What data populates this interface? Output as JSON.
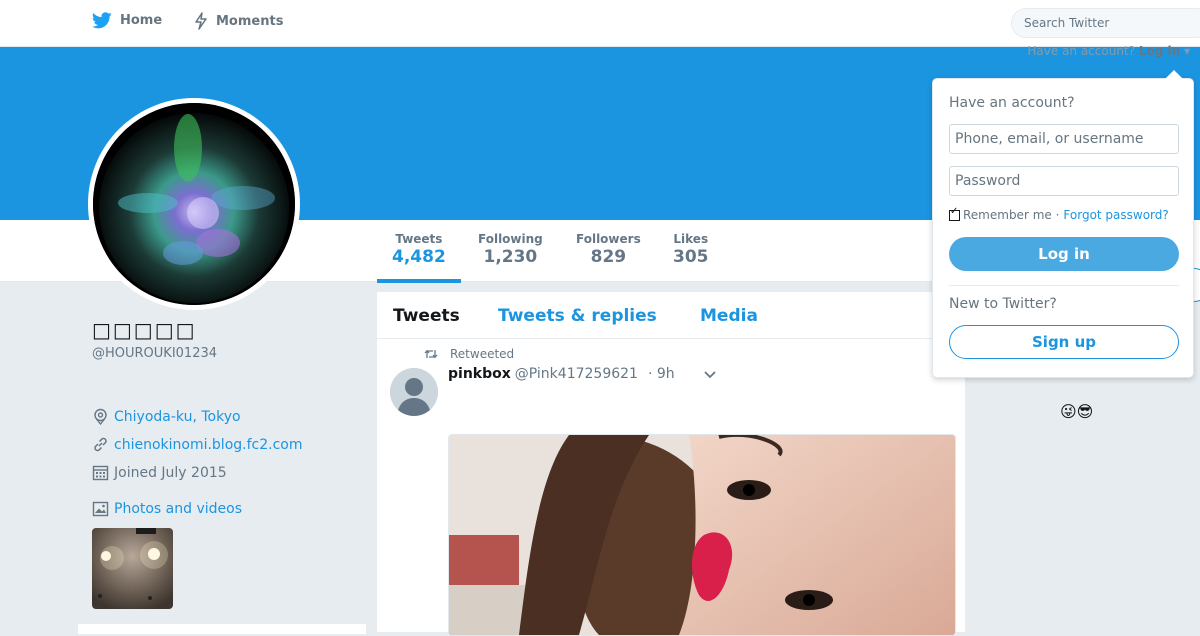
{
  "nav": {
    "home_label": "Home",
    "moments_label": "Moments",
    "search_placeholder": "Search Twitter",
    "have_account": "Have an account?",
    "login_link": "Log in"
  },
  "profile": {
    "name": "□□□□□",
    "handle": "@HOUROUKI01234",
    "location": "Chiyoda-ku, Tokyo",
    "website": "chienokinomi.blog.fc2.com",
    "joined": "Joined July 2015",
    "photos_label": "Photos and videos"
  },
  "stats": [
    {
      "label": "Tweets",
      "value": "4,482",
      "active": true
    },
    {
      "label": "Following",
      "value": "1,230",
      "active": false
    },
    {
      "label": "Followers",
      "value": "829",
      "active": false
    },
    {
      "label": "Likes",
      "value": "305",
      "active": false
    }
  ],
  "timeline": {
    "tabs": [
      {
        "label": "Tweets",
        "active": true
      },
      {
        "label": "Tweets & replies",
        "active": false
      },
      {
        "label": "Media",
        "active": false
      }
    ],
    "tweet": {
      "retweet_label": "Retweeted",
      "name": "pinkbox",
      "handle": "@Pink417259621",
      "time": "· 9h"
    }
  },
  "login_dropdown": {
    "title": "Have an account?",
    "username_placeholder": "Phone, email, or username",
    "password_placeholder": "Password",
    "remember_label": "Remember me",
    "forgot_label": "Forgot password?",
    "login_button": "Log in",
    "new_label": "New to Twitter?",
    "signup_button": "Sign up"
  },
  "right_emojis": "😜😎",
  "colors": {
    "accent": "#1b95e0",
    "banner": "#1b95e0",
    "page_bg": "#e6ecf0",
    "text_secondary": "#657786"
  },
  "icons": {
    "home": "twitter-bird-icon",
    "moments": "lightning-icon",
    "location": "map-pin-icon",
    "website": "link-icon",
    "joined": "calendar-icon",
    "photos": "image-icon",
    "retweet": "retweet-icon",
    "caret": "chevron-down-icon"
  }
}
